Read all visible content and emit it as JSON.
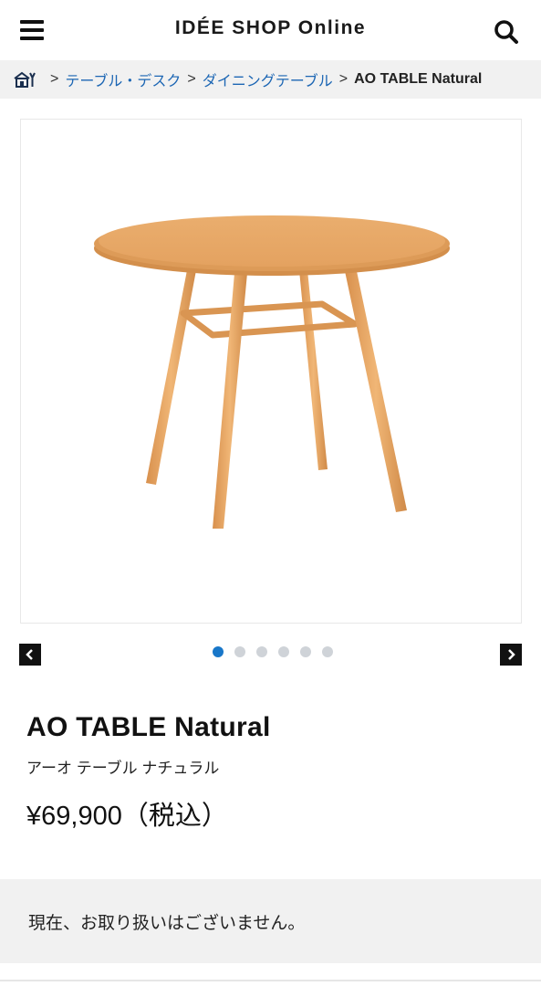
{
  "header": {
    "title": "IDÉE SHOP Online",
    "menu_icon": "hamburger-menu-icon",
    "search_icon": "search-icon"
  },
  "breadcrumb": {
    "home_icon": "home-icon",
    "separator": ">",
    "items": [
      {
        "label": "テーブル・デスク"
      },
      {
        "label": "ダイニングテーブル"
      },
      {
        "label": "AO TABLE Natural"
      }
    ]
  },
  "gallery": {
    "image_icon": "round-wooden-table-image",
    "slide_count": 6,
    "active_index": 0,
    "prev_icon": "chevron-left-icon",
    "next_icon": "chevron-right-icon"
  },
  "product": {
    "name": "AO TABLE Natural",
    "name_kana": "アーオ テーブル ナチュラル",
    "price": "¥69,900（税込）"
  },
  "availability": {
    "message": "現在、お取り扱いはございません。"
  },
  "colors": {
    "link": "#1c66b4",
    "dot_active": "#1877c9",
    "dot_inactive": "#cfd3d8",
    "panel_bg": "#f1f1f1",
    "wood": "#e7a866"
  }
}
